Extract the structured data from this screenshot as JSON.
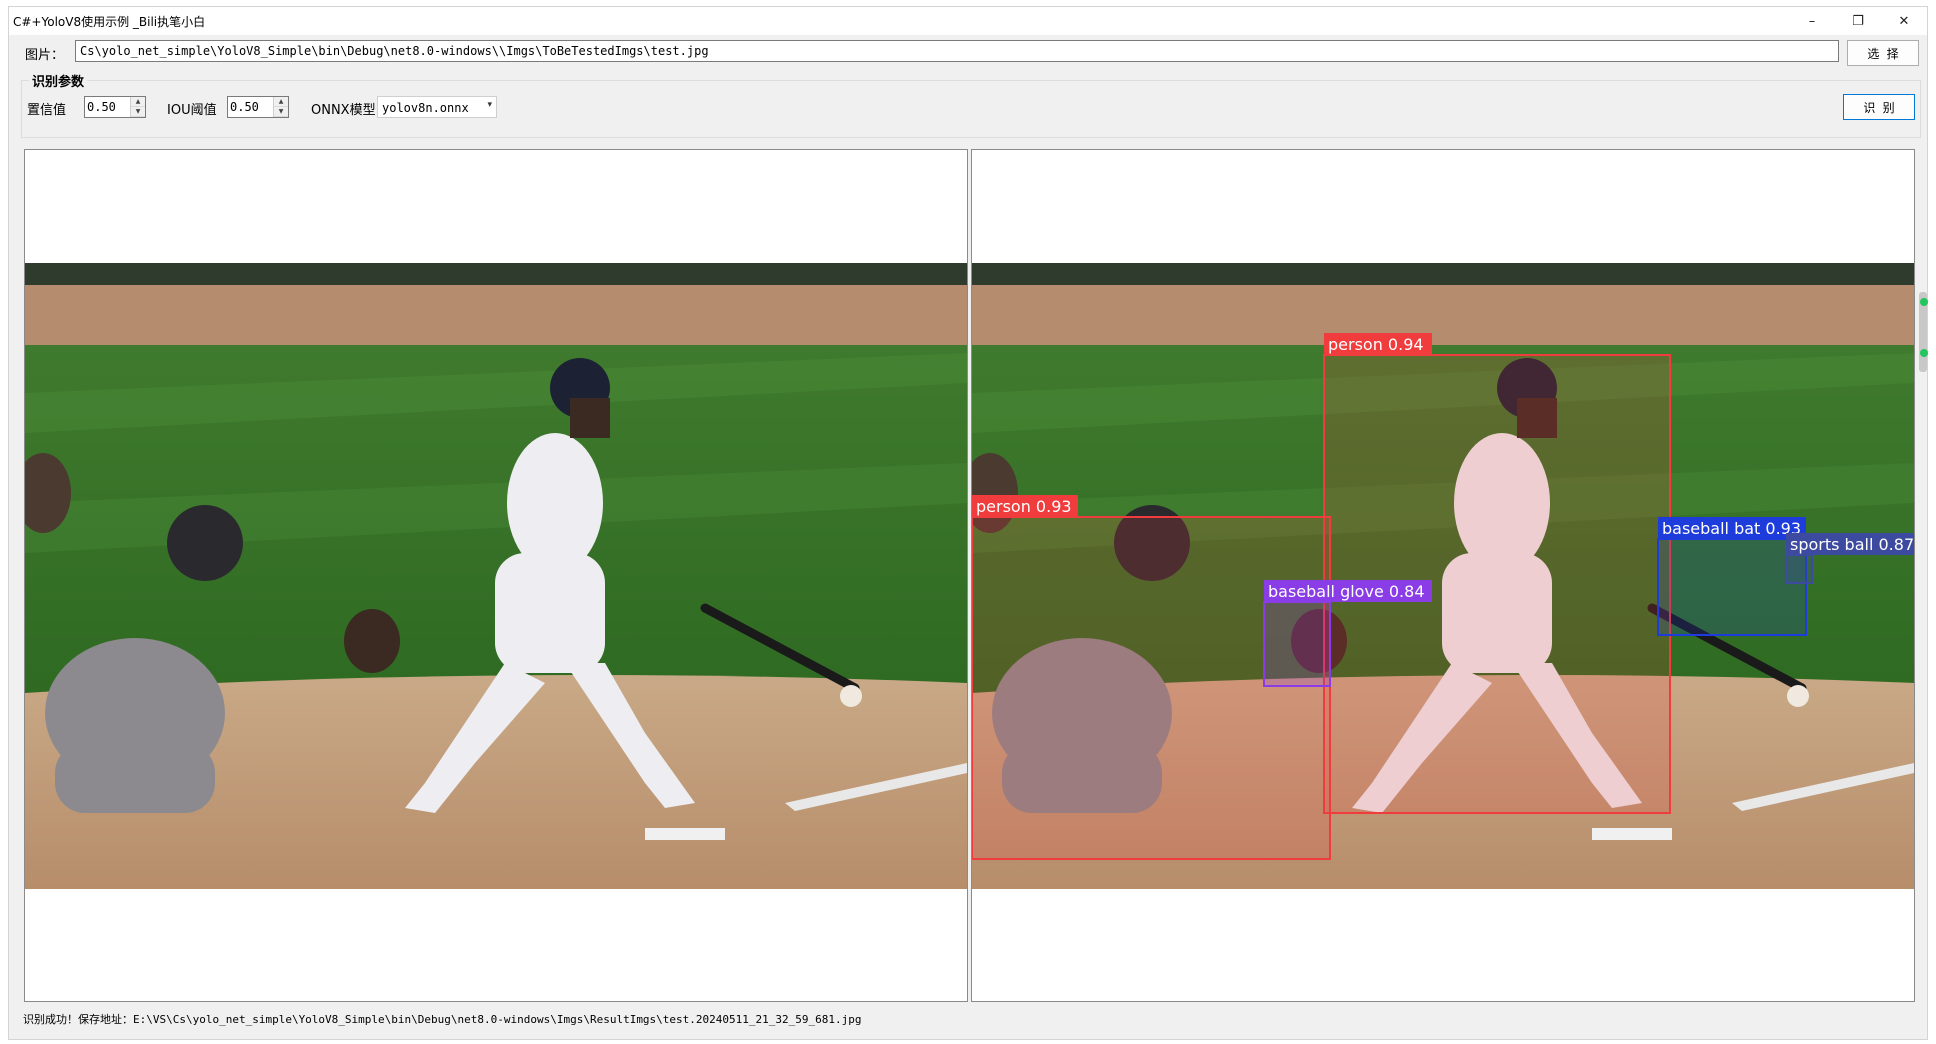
{
  "window": {
    "title": "C#+YoloV8使用示例 _Bili执笔小白",
    "minimize_glyph": "–",
    "restore_glyph": "❐",
    "close_glyph": "✕"
  },
  "image_row": {
    "label": "图片：",
    "path": "Cs\\yolo_net_simple\\YoloV8_Simple\\bin\\Debug\\net8.0-windows\\\\Imgs\\ToBeTestedImgs\\test.jpg",
    "select_button": "选 择"
  },
  "params": {
    "group_title": "识别参数",
    "confidence_label": "置信值",
    "confidence_value": "0.50",
    "iou_label": "IOU阈值",
    "iou_value": "0.50",
    "model_label": "ONNX模型",
    "model_value": "yolov8n.onnx",
    "detect_button": "识 别"
  },
  "detections": [
    {
      "label": "person 0.94",
      "color": "#f03c3c"
    },
    {
      "label": "person 0.93",
      "color": "#f03c3c"
    },
    {
      "label": "baseball glove 0.84",
      "color": "#8a3ce6"
    },
    {
      "label": "baseball bat 0.93",
      "color": "#1e3cdc"
    },
    {
      "label": "sports ball 0.87",
      "color": "#3c4aa0"
    }
  ],
  "status": {
    "text": "识别成功！保存地址：E:\\VS\\Cs\\yolo_net_simple\\YoloV8_Simple\\bin\\Debug\\net8.0-windows\\Imgs\\ResultImgs\\test.20240511_21_32_59_681.jpg"
  },
  "icons": {
    "spin_up": "arrow-up-icon",
    "spin_down": "arrow-down-icon",
    "combo": "chevron-down-icon"
  }
}
